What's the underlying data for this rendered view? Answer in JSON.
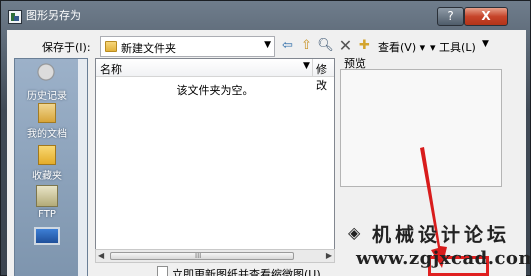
{
  "window": {
    "title": "图形另存为",
    "help_label": "?",
    "close_label": "X"
  },
  "toolbar": {
    "save_in_label": "保存于(I):",
    "path_value": "新建文件夹",
    "view_label": "查看(V)",
    "tools_label": "工具(L)"
  },
  "places": [
    {
      "label": "历史记录",
      "icon": "history-icon"
    },
    {
      "label": "我的文档",
      "icon": "documents-icon"
    },
    {
      "label": "收藏夹",
      "icon": "favorites-icon"
    },
    {
      "label": "FTP",
      "icon": "ftp-icon"
    },
    {
      "label": "",
      "icon": "desktop-icon"
    }
  ],
  "file_list": {
    "columns": [
      "名称",
      "修改"
    ],
    "empty_message": "该文件夹为空。",
    "scroll_grip": "III"
  },
  "preview": {
    "label": "预览"
  },
  "options": {
    "update_thumbnail_label": "立即更新图纸并查看缩微图(U)"
  },
  "watermark": {
    "title": "机械设计论坛",
    "url": "www.zgjxcad.com"
  },
  "colors": {
    "highlight_box": "#e02020"
  }
}
